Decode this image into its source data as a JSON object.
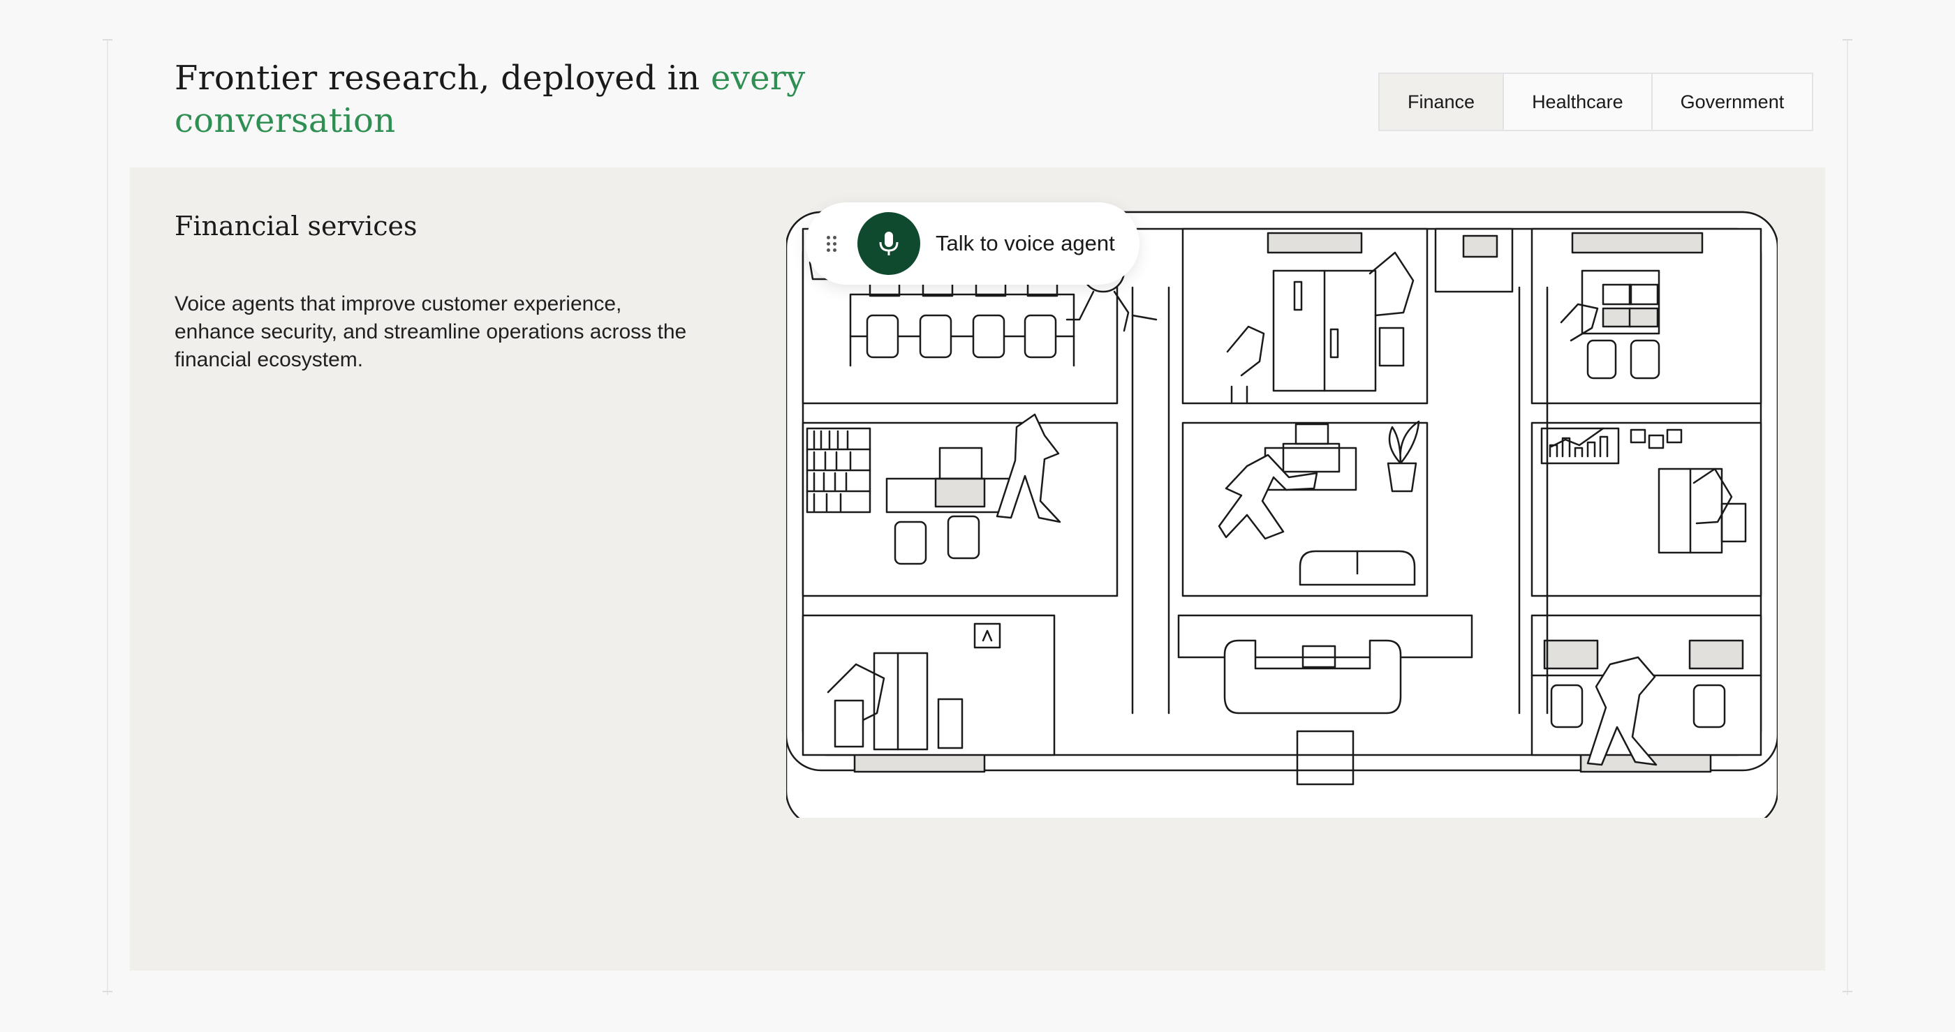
{
  "header": {
    "headline_part1": "Frontier research, deployed in ",
    "headline_accent": "every conversation",
    "accent_color": "#2f8f52"
  },
  "tabs": [
    {
      "label": "Finance",
      "active": true
    },
    {
      "label": "Healthcare",
      "active": false
    },
    {
      "label": "Government",
      "active": false
    }
  ],
  "panel": {
    "title": "Financial services",
    "description": "Voice agents that improve customer experience, enhance security, and streamline operations across the financial ecosystem.",
    "background": "#f1efec"
  },
  "voice_agent": {
    "label": "Talk to voice agent",
    "button_color": "#0f4a2e",
    "icons": [
      "drag-handle-icon",
      "microphone-icon"
    ]
  }
}
